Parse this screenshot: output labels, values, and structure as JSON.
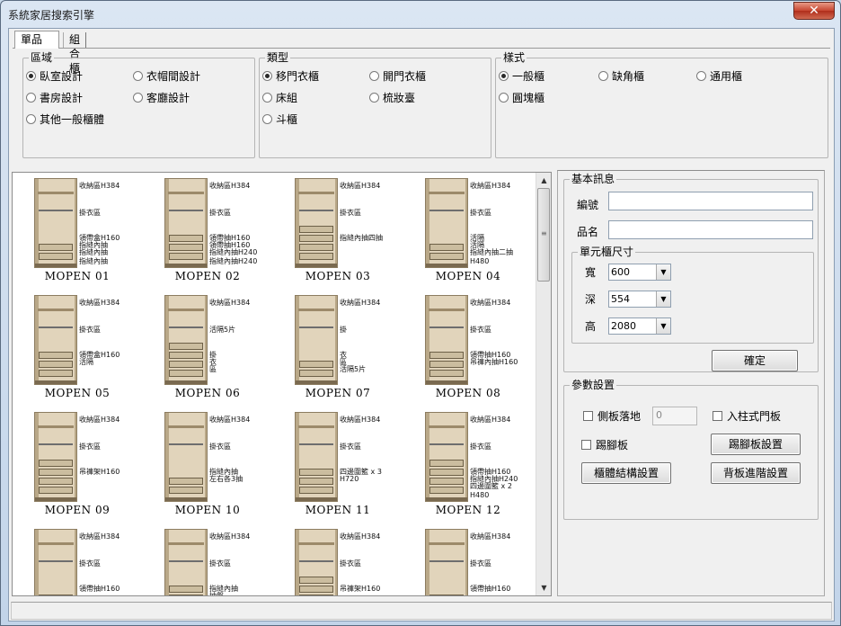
{
  "window": {
    "title": "系統家居搜索引擎",
    "close_glyph": "✕"
  },
  "tabs": [
    {
      "label": "單品"
    },
    {
      "label": "組合櫃"
    }
  ],
  "area": {
    "title": "區域",
    "options": [
      "臥室設計",
      "衣帽間設計",
      "書房設計",
      "客廳設計",
      "其他一般櫃體"
    ],
    "selected": "臥室設計"
  },
  "type": {
    "title": "類型",
    "options": [
      "移門衣櫃",
      "開門衣櫃",
      "床組",
      "梳妝臺",
      "斗櫃"
    ],
    "selected": "移門衣櫃"
  },
  "style": {
    "title": "樣式",
    "options": [
      "一般櫃",
      "缺角櫃",
      "通用櫃",
      "圓塊櫃"
    ],
    "selected": "一般櫃"
  },
  "gallery": {
    "items": [
      {
        "caption": "MOPEN  01",
        "labels": [
          "收納區H384",
          "掛衣區",
          "領帶盒H160",
          "指縫內抽",
          "指縫內抽",
          "指縫內抽"
        ]
      },
      {
        "caption": "MOPEN 02",
        "labels": [
          "收納區H384",
          "掛衣區",
          "領帶抽H160",
          "領帶抽H160",
          "指縫內抽H240",
          "指縫內抽H240"
        ]
      },
      {
        "caption": "MOPEN 03",
        "labels": [
          "收納區H384",
          "掛衣區",
          "指縫內抽四抽"
        ]
      },
      {
        "caption": "MOPEN  04",
        "labels": [
          "收納區H384",
          "掛衣區",
          "活隔",
          "活隔",
          "指縫內抽二抽",
          "H480"
        ]
      },
      {
        "caption": "MOPEN 05",
        "labels": [
          "收納區H384",
          "掛衣區",
          "領帶盒H160",
          "活隔"
        ]
      },
      {
        "caption": "MOPEN 06",
        "labels": [
          "收納區H384",
          "活隔5片",
          "掛",
          "衣",
          "區"
        ]
      },
      {
        "caption": "MOPEN 07",
        "labels": [
          "收納區H384",
          "掛",
          "衣",
          "區",
          "活隔5片"
        ]
      },
      {
        "caption": "MOPEN 08",
        "labels": [
          "收納區H384",
          "掛衣區",
          "領帶抽H160",
          "吊褲內抽H160"
        ]
      },
      {
        "caption": "MOPEN 09",
        "labels": [
          "收納區H384",
          "掛衣區",
          "吊褲架H160"
        ]
      },
      {
        "caption": "MOPEN 10",
        "labels": [
          "收納區H384",
          "掛衣區",
          "指縫內抽",
          "左右各3抽"
        ]
      },
      {
        "caption": "MOPEN 11",
        "labels": [
          "收納區H384",
          "掛衣區",
          "四邊圍籃 x 3",
          "H720"
        ]
      },
      {
        "caption": "MOPEN 12",
        "labels": [
          "收納區H384",
          "掛衣區",
          "領帶抽H160",
          "指縫內抽H240",
          "四邊圍籃 x 2",
          "H480"
        ]
      },
      {
        "caption": "",
        "labels": [
          "收納區H384",
          "掛衣區",
          "領帶抽H160"
        ]
      },
      {
        "caption": "",
        "labels": [
          "收納區H384",
          "掛衣區",
          "指縫內抽",
          "抽盤"
        ]
      },
      {
        "caption": "",
        "labels": [
          "收納區H384",
          "掛衣區",
          "吊褲架H160"
        ]
      },
      {
        "caption": "",
        "labels": [
          "收納區H384",
          "掛衣區",
          "領帶抽H160"
        ]
      }
    ]
  },
  "basic_info": {
    "title": "基本訊息",
    "code_label": "編號",
    "code_value": "",
    "name_label": "品名",
    "name_value": "",
    "unit_size": {
      "title": "單元櫃尺寸",
      "width_label": "寬",
      "width_value": "600",
      "depth_label": "深",
      "depth_value": "554",
      "height_label": "高",
      "height_value": "2080"
    },
    "confirm_label": "確定"
  },
  "params": {
    "title": "參數設置",
    "side_floor_label": "側板落地",
    "side_floor_value": "0",
    "embedded_door_label": "入柱式門板",
    "kickboard_label": "踢腳板",
    "kickboard_settings_label": "踢腳板設置",
    "structure_settings_label": "櫃體結構設置",
    "backboard_settings_label": "背板進階設置"
  }
}
